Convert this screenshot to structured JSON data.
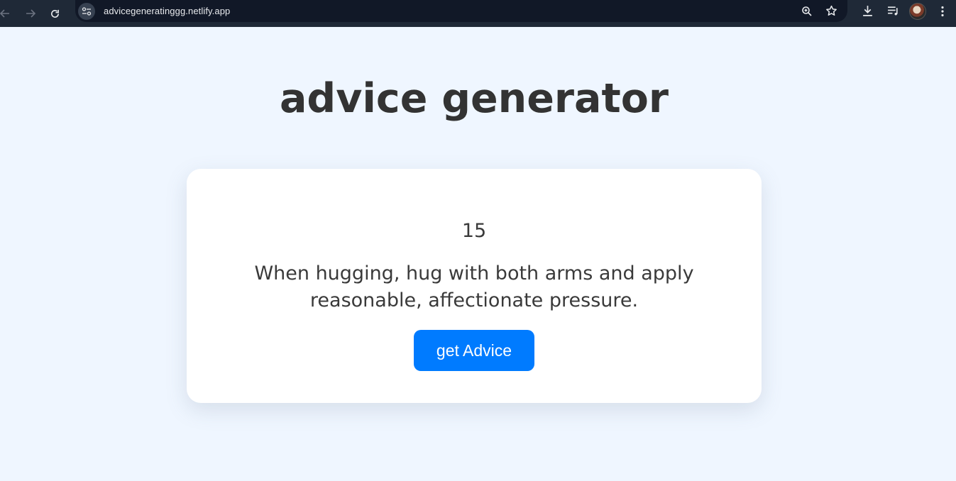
{
  "browser": {
    "url": "advicegeneratinggg.netlify.app",
    "icons": [
      "back-icon",
      "forward-icon",
      "reload-icon",
      "site-info-icon",
      "zoom-icon",
      "bookmark-star-icon",
      "download-icon",
      "media-controls-icon",
      "profile-avatar",
      "more-menu-icon"
    ],
    "frame_color": "#1f2937"
  },
  "page": {
    "title": "advice generator",
    "background_color": "#eff6ff"
  },
  "card": {
    "advice_id": "15",
    "advice_text": "When hugging, hug with both arms and apply reasonable, affectionate pressure.",
    "button_label": "get Advice",
    "button_color": "#007bff"
  }
}
